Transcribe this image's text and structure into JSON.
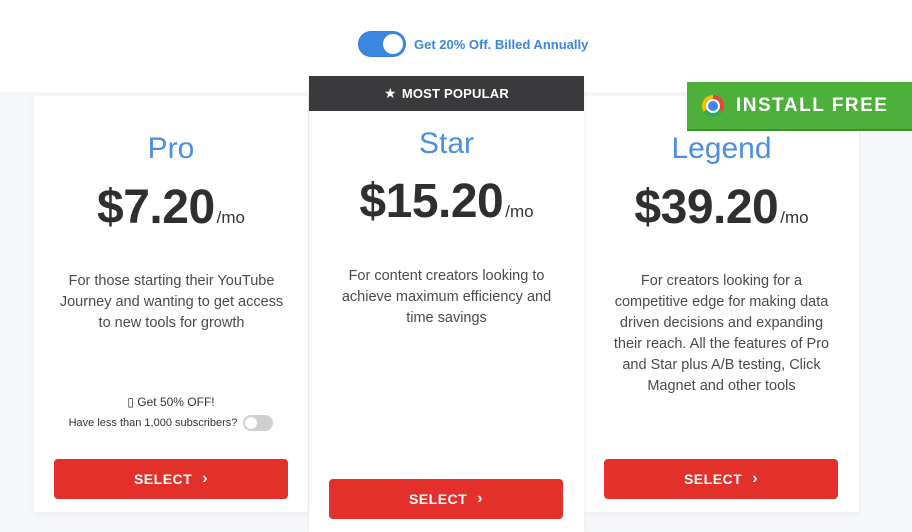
{
  "billing": {
    "label": "Get 20% Off. Billed Annually",
    "annual_enabled": true
  },
  "install": {
    "label": "INSTALL FREE"
  },
  "plans": [
    {
      "name": "Pro",
      "price": "$7.20",
      "per": "/mo",
      "description": "For those starting their YouTube Journey and wanting to get access to new tools for growth",
      "discount": "▯ Get 50% OFF!",
      "subscribers_label": "Have less than 1,000 subscribers?",
      "subscribers_toggle_on": false,
      "select_label": "SELECT"
    },
    {
      "name": "Star",
      "badge": "MOST POPULAR",
      "price": "$15.20",
      "per": "/mo",
      "description": "For content creators looking to achieve maximum efficiency and time savings",
      "select_label": "SELECT"
    },
    {
      "name": "Legend",
      "price": "$39.20",
      "per": "/mo",
      "description": "For creators looking for a competitive edge for making data driven decisions and expanding their reach. All the features of Pro and Star plus A/B testing, Click Magnet and other tools",
      "select_label": "SELECT"
    }
  ],
  "colors": {
    "accent": "#3b86e0",
    "select": "#e3302a",
    "install": "#4db03a",
    "banner": "#3a3a3c"
  }
}
